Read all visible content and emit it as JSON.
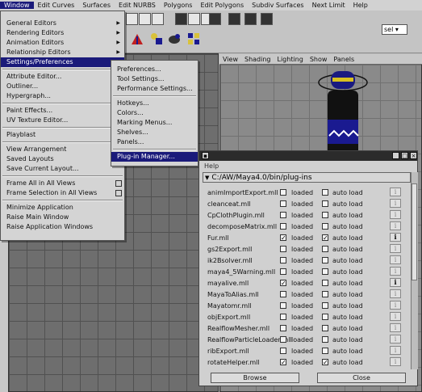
{
  "menubar": [
    "Window",
    "Edit Curves",
    "Surfaces",
    "Edit NURBS",
    "Polygons",
    "Edit Polygons",
    "Subdiv Surfaces",
    "Next Limit",
    "Help"
  ],
  "toolbar": {
    "sel_label": "sel"
  },
  "viewport_menu": [
    "View",
    "Shading",
    "Lighting",
    "Show",
    "Panels"
  ],
  "window_menu": {
    "items": [
      {
        "label": "General Editors",
        "submenu": true
      },
      {
        "label": "Rendering Editors",
        "submenu": true
      },
      {
        "label": "Animation Editors",
        "submenu": true
      },
      {
        "label": "Relationship Editors",
        "submenu": true
      },
      {
        "label": "Settings/Preferences",
        "submenu": true,
        "highlighted": true
      },
      {
        "sep": true
      },
      {
        "label": "Attribute Editor..."
      },
      {
        "label": "Outliner..."
      },
      {
        "label": "Hypergraph..."
      },
      {
        "sep": true
      },
      {
        "label": "Paint Effects..."
      },
      {
        "label": "UV Texture Editor..."
      },
      {
        "sep": true
      },
      {
        "label": "Playblast",
        "option": true
      },
      {
        "sep": true
      },
      {
        "label": "View Arrangement",
        "submenu": true
      },
      {
        "label": "Saved Layouts",
        "submenu": true
      },
      {
        "label": "Save Current Layout..."
      },
      {
        "sep": true
      },
      {
        "label": "Frame All in All Views",
        "option": true
      },
      {
        "label": "Frame Selection in All Views",
        "option": true
      },
      {
        "sep": true
      },
      {
        "label": "Minimize Application"
      },
      {
        "label": "Raise Main Window"
      },
      {
        "label": "Raise Application Windows"
      }
    ]
  },
  "settings_menu": {
    "items": [
      {
        "label": "Preferences..."
      },
      {
        "label": "Tool Settings..."
      },
      {
        "label": "Performance Settings..."
      },
      {
        "sep": true
      },
      {
        "label": "Hotkeys..."
      },
      {
        "label": "Colors..."
      },
      {
        "label": "Marking Menus..."
      },
      {
        "label": "Shelves..."
      },
      {
        "label": "Panels..."
      },
      {
        "sep": true
      },
      {
        "label": "Plug-in Manager...",
        "highlighted": true
      }
    ]
  },
  "plugin_manager": {
    "help": "Help",
    "path": "C:/AW/Maya4.0/bin/plug-ins",
    "loaded_label": "loaded",
    "autoload_label": "auto load",
    "browse_label": "Browse",
    "close_label": "Close",
    "plugins": [
      {
        "name": "animImportExport.mll",
        "loaded": false,
        "auto": false,
        "info": false
      },
      {
        "name": "cleanceat.mll",
        "loaded": false,
        "auto": false,
        "info": false
      },
      {
        "name": "CpClothPlugin.mll",
        "loaded": false,
        "auto": false,
        "info": false
      },
      {
        "name": "decomposeMatrix.mll",
        "loaded": false,
        "auto": false,
        "info": false
      },
      {
        "name": "Fur.mll",
        "loaded": true,
        "auto": true,
        "info": true
      },
      {
        "name": "gs2Export.mll",
        "loaded": false,
        "auto": false,
        "info": false
      },
      {
        "name": "ik2Bsolver.mll",
        "loaded": false,
        "auto": false,
        "info": false
      },
      {
        "name": "maya4_5Warning.mll",
        "loaded": false,
        "auto": false,
        "info": false
      },
      {
        "name": "mayalive.mll",
        "loaded": true,
        "auto": false,
        "info": true
      },
      {
        "name": "MayaToAlias.mll",
        "loaded": false,
        "auto": false,
        "info": false
      },
      {
        "name": "Mayatomr.mll",
        "loaded": false,
        "auto": false,
        "info": false
      },
      {
        "name": "objExport.mll",
        "loaded": false,
        "auto": false,
        "info": false
      },
      {
        "name": "RealflowMesher.mll",
        "loaded": false,
        "auto": false,
        "info": false
      },
      {
        "name": "RealflowParticleLoader.mll",
        "loaded": false,
        "auto": false,
        "info": false
      },
      {
        "name": "ribExport.mll",
        "loaded": false,
        "auto": false,
        "info": false
      },
      {
        "name": "rotateHelper.mll",
        "loaded": true,
        "auto": true,
        "info": false
      }
    ]
  }
}
